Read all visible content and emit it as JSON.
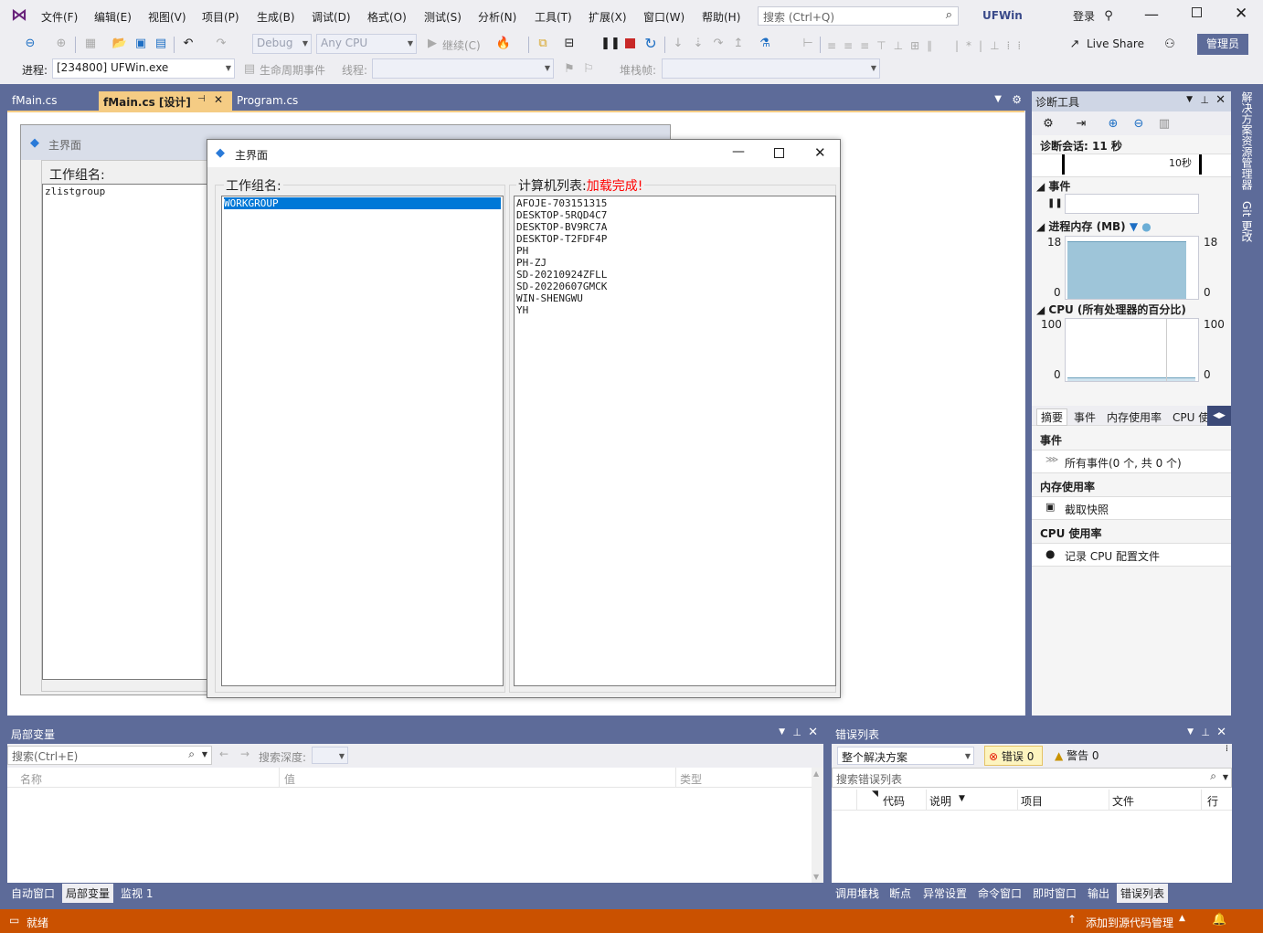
{
  "menu": {
    "items": [
      "文件(F)",
      "编辑(E)",
      "视图(V)",
      "项目(P)",
      "生成(B)",
      "调试(D)",
      "格式(O)",
      "测试(S)",
      "分析(N)",
      "工具(T)",
      "扩展(X)",
      "窗口(W)",
      "帮助(H)"
    ]
  },
  "search": {
    "placeholder": "搜索 (Ctrl+Q)"
  },
  "app_title": "UFWin",
  "login_label": "登录",
  "toolbar1": {
    "config": "Debug",
    "platform": "Any CPU",
    "continue_label": "继续(C)",
    "live_share": "Live Share",
    "admin": "管理员"
  },
  "toolbar2": {
    "process_label": "进程:",
    "process_value": "[234800] UFWin.exe",
    "lifecycle_label": "生命周期事件",
    "thread_label": "线程:",
    "stack_label": "堆栈帧:"
  },
  "doc_tabs": [
    "fMain.cs",
    "fMain.cs [设计]",
    "Program.cs"
  ],
  "designer": {
    "back_title": "主界面",
    "back_group_label": "工作组名:",
    "back_group_value": "zlistgroup",
    "front_title": "主界面",
    "workgroup_label": "工作组名:",
    "workgroups": [
      "WORKGROUP"
    ],
    "computer_label": "计算机列表:",
    "computer_status": "加载完成!",
    "computers": [
      "AFOJE-703151315",
      "DESKTOP-5RQD4C7",
      "DESKTOP-BV9RC7A",
      "DESKTOP-T2FDF4P",
      "PH",
      "PH-ZJ",
      "SD-20210924ZFLL",
      "SD-20220607GMCK",
      "WIN-SHENGWU",
      "YH"
    ]
  },
  "diag": {
    "title": "诊断工具",
    "session": "诊断会话: 11 秒",
    "time_tick": "10秒",
    "events_label": "事件",
    "memory_label": "进程内存 (MB)",
    "memory_max": "18",
    "memory_min": "0",
    "memory_fill_fraction": 0.93,
    "cpu_label": "CPU (所有处理器的百分比)",
    "cpu_max": "100",
    "cpu_min": "0",
    "tabs": [
      "摘要",
      "事件",
      "内存使用率",
      "CPU 使"
    ],
    "section_events": "事件",
    "all_events": "所有事件(0 个, 共 0 个)",
    "section_memory": "内存使用率",
    "snapshot": "截取快照",
    "section_cpu": "CPU 使用率",
    "record_cpu": "记录 CPU 配置文件"
  },
  "right_rail": [
    "解决方案资源管理器",
    "Git 更改"
  ],
  "locals": {
    "title": "局部变量",
    "search_placeholder": "搜索(Ctrl+E)",
    "depth_label": "搜索深度:",
    "columns": [
      "名称",
      "值",
      "类型"
    ],
    "tabs": [
      "自动窗口",
      "局部变量",
      "监视 1"
    ]
  },
  "errors": {
    "title": "错误列表",
    "scope": "整个解决方案",
    "errors_btn": "错误 0",
    "warnings_btn": "警告 0",
    "search_placeholder": "搜索错误列表",
    "columns": [
      "代码",
      "说明",
      "项目",
      "文件",
      "行"
    ],
    "tabs": [
      "调用堆栈",
      "断点",
      "异常设置",
      "命令窗口",
      "即时窗口",
      "输出",
      "错误列表"
    ]
  },
  "status": {
    "ready": "就绪",
    "source_control": "添加到源代码管理"
  },
  "colors": {
    "accent": "#5d6b99",
    "status_bar": "#ca5100",
    "active_tab": "#f5cc84",
    "error_status": "#ff0000",
    "selection": "#0078d7"
  }
}
